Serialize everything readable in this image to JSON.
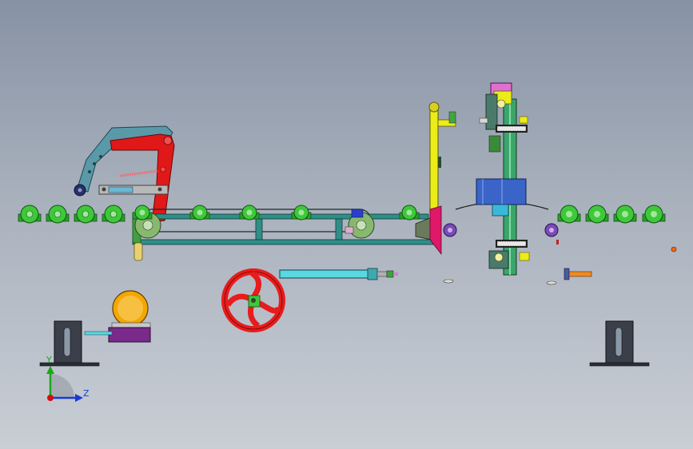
{
  "viewport": {
    "background_top": "#8792a4",
    "background_bottom": "#c9ced5"
  },
  "triad": {
    "y_label": "Y",
    "z_label": "Z",
    "y_color": "#1aa81a",
    "z_color": "#1a3ad8",
    "origin_color": "#d01010"
  },
  "colors": {
    "roller_green": "#3ec83a",
    "frame_teal": "#2f8f88",
    "arm_red": "#e01818",
    "arm_blue": "#5a9aa8",
    "wheel_red": "#e81c1c",
    "guide_yellow": "#ecec18",
    "motor_orange": "#f2a800",
    "base_purple": "#7a2a8a",
    "column_green": "#3aa66a"
  },
  "components": {
    "left_rollers": "conveyor-roller",
    "right_rollers": "conveyor-roller",
    "handwheel": "handwheel",
    "cylinder": "pneumatic-cylinder",
    "gearmotor": "gear-motor",
    "stands": "support-stand"
  }
}
